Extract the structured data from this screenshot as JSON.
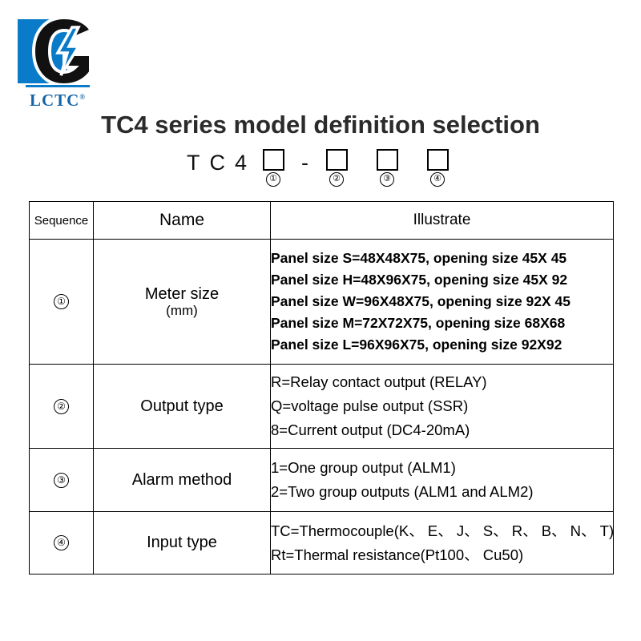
{
  "logo": {
    "wordmark": "LCTC",
    "registered_mark": "®",
    "brand_blue": "#0a7bc8",
    "mark_icon": "lctc-c-lightning-logo"
  },
  "title": "TC4 series model definition selection",
  "model_code": {
    "letters": [
      "T",
      "C",
      "4"
    ],
    "separator": "-",
    "slots": [
      {
        "box": "",
        "number": "①"
      },
      {
        "box": "",
        "number": "②"
      },
      {
        "box": "",
        "number": "③"
      },
      {
        "box": "",
        "number": "④"
      }
    ]
  },
  "table": {
    "headers": [
      "Sequence",
      "Name",
      "Illustrate"
    ],
    "rows": [
      {
        "sequence": "①",
        "name": "Meter size",
        "name_sub": "(mm)",
        "illustrate": [
          "Panel size S=48X48X75, opening size 45X 45",
          "Panel size H=48X96X75, opening size 45X 92",
          "Panel size W=96X48X75, opening size 92X 45",
          "Panel size M=72X72X75, opening size 68X68",
          "Panel size L=96X96X75, opening size 92X92"
        ]
      },
      {
        "sequence": "②",
        "name": "Output type",
        "name_sub": "",
        "illustrate": [
          "R=Relay contact output (RELAY)",
          "Q=voltage pulse output (SSR)",
          "8=Current output (DC4-20mA)"
        ]
      },
      {
        "sequence": "③",
        "name": "Alarm method",
        "name_sub": "",
        "illustrate": [
          "1=One group output (ALM1)",
          "2=Two group outputs (ALM1 and ALM2)"
        ]
      },
      {
        "sequence": "④",
        "name": "Input type",
        "name_sub": "",
        "illustrate": [
          "TC=Thermocouple(K、 E、 J、 S、 R、 B、 N、 T)",
          "Rt=Thermal resistance(Pt100、 Cu50)"
        ]
      }
    ]
  }
}
